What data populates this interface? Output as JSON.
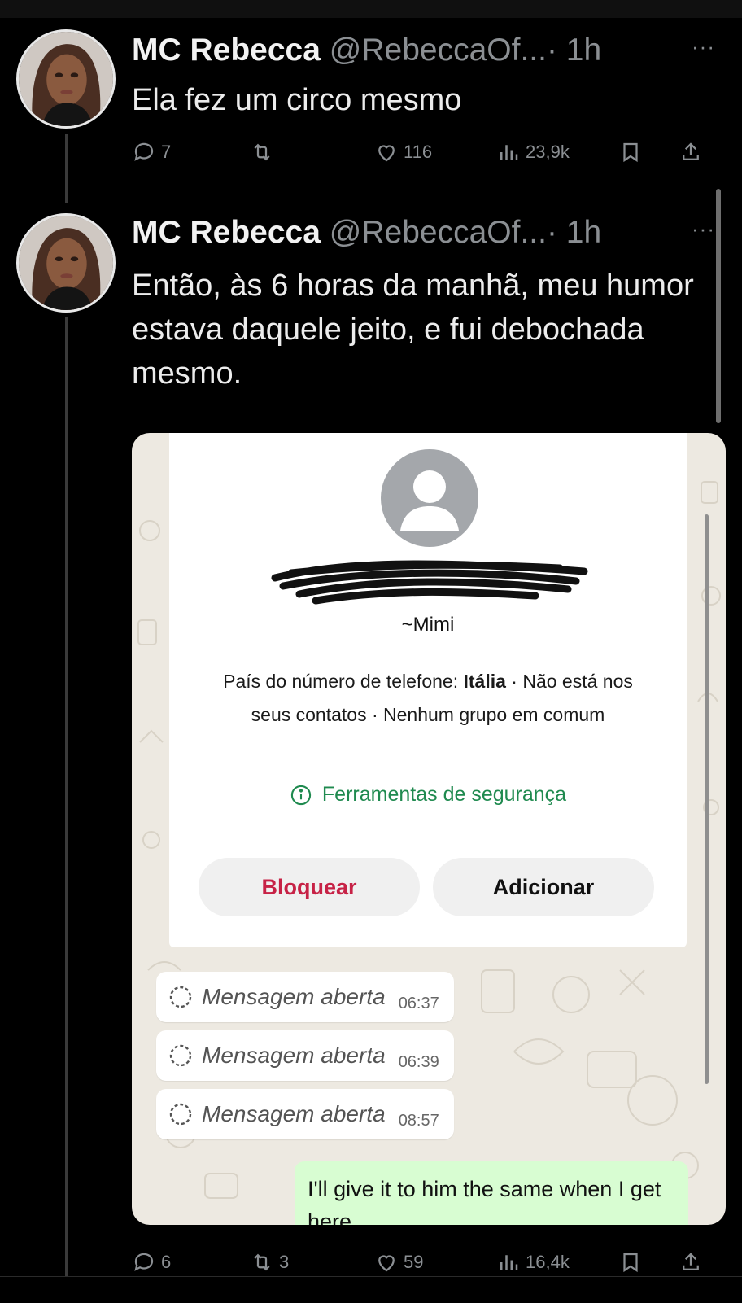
{
  "tweets": [
    {
      "name": "MC Rebecca",
      "handle": "@RebeccaOf...",
      "time": "· 1h",
      "text": "Ela fez um circo mesmo",
      "more": "···",
      "stats": {
        "replies": "7",
        "retweets": "",
        "likes": "116",
        "views": "23,9k"
      }
    },
    {
      "name": "MC Rebecca",
      "handle": "@RebeccaOf...",
      "time": "· 1h",
      "text": "Então, às 6 horas da manhã, meu humor estava daquele jeito, e fui debochada mesmo.",
      "more": "···",
      "stats": {
        "replies": "6",
        "retweets": "3",
        "likes": "59",
        "views": "16,4k"
      }
    }
  ],
  "whatsapp": {
    "contact_name": "~Mimi",
    "info_prefix": "País do número de telefone: ",
    "info_country": "Itália",
    "info_suffix": " · Não está nos seus contatos · Nenhum grupo em comum",
    "safety_tools": "Ferramentas de segurança",
    "block_label": "Bloquear",
    "add_label": "Adicionar",
    "messages": [
      {
        "text": "Mensagem aberta",
        "time": "06:37"
      },
      {
        "text": "Mensagem aberta",
        "time": "06:39"
      },
      {
        "text": "Mensagem aberta",
        "time": "08:57"
      }
    ],
    "outgoing_text": "I'll give it to him the same when I get here"
  },
  "colors": {
    "background": "#000000",
    "muted": "#8b8f93",
    "block_red": "#c72246",
    "safety_green": "#1f8a4f",
    "outgoing_bubble": "#d8fdd2"
  },
  "icons": [
    "reply-icon",
    "retweet-icon",
    "like-icon",
    "views-icon",
    "bookmark-icon",
    "share-icon",
    "info-icon",
    "loading-icon",
    "default-avatar-icon"
  ]
}
